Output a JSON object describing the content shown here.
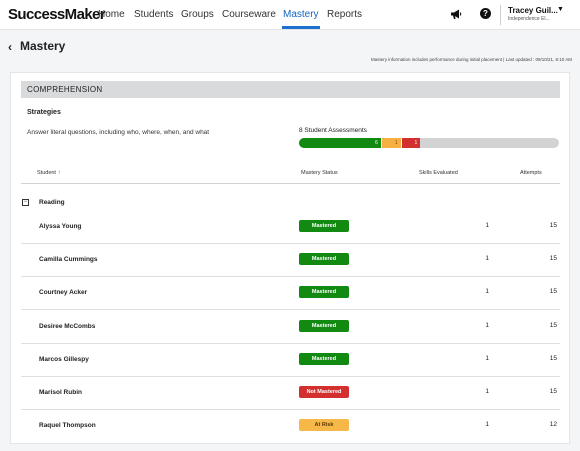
{
  "nav": {
    "logo": "SuccessMaker",
    "items": [
      "Home",
      "Students",
      "Groups",
      "Courseware",
      "Mastery",
      "Reports"
    ],
    "active": "Mastery",
    "user_name": "Tracey Guil...",
    "user_school": "Independence El..."
  },
  "page": {
    "title": "Mastery",
    "note": "Mastery information includes performance during initial placement  |  Last updated : 09/10/21, 8:10 AM"
  },
  "section": {
    "title": "COMPREHENSION",
    "subtitle": "Strategies",
    "skill": "Answer literal questions, including who, where, when, and what",
    "assessments_label": "8 Student Assessments",
    "progress": {
      "total": 8,
      "mastered": 6,
      "at_risk": 1,
      "not_mastered": 1,
      "colors": {
        "mastered": "#128a12",
        "at_risk": "#f5b041",
        "not_mastered": "#d32f2f",
        "empty": "#d3d3d3"
      }
    }
  },
  "table": {
    "headers": {
      "student": "Student",
      "status": "Mastery Status",
      "skills": "Skills Evaluated",
      "attempts": "Attempts"
    },
    "group": "Reading",
    "rows": [
      {
        "name": "Alyssa Young",
        "status": "Mastered",
        "skills": "1",
        "attempts": "15"
      },
      {
        "name": "Camilla Cummings",
        "status": "Mastered",
        "skills": "1",
        "attempts": "15"
      },
      {
        "name": "Courtney Acker",
        "status": "Mastered",
        "skills": "1",
        "attempts": "15"
      },
      {
        "name": "Desiree McCombs",
        "status": "Mastered",
        "skills": "1",
        "attempts": "15"
      },
      {
        "name": "Marcos Gillespy",
        "status": "Mastered",
        "skills": "1",
        "attempts": "15"
      },
      {
        "name": "Marisol Rubin",
        "status": "Not Mastered",
        "skills": "1",
        "attempts": "15"
      },
      {
        "name": "Raquel Thompson",
        "status": "At Risk",
        "skills": "1",
        "attempts": "12"
      }
    ]
  }
}
